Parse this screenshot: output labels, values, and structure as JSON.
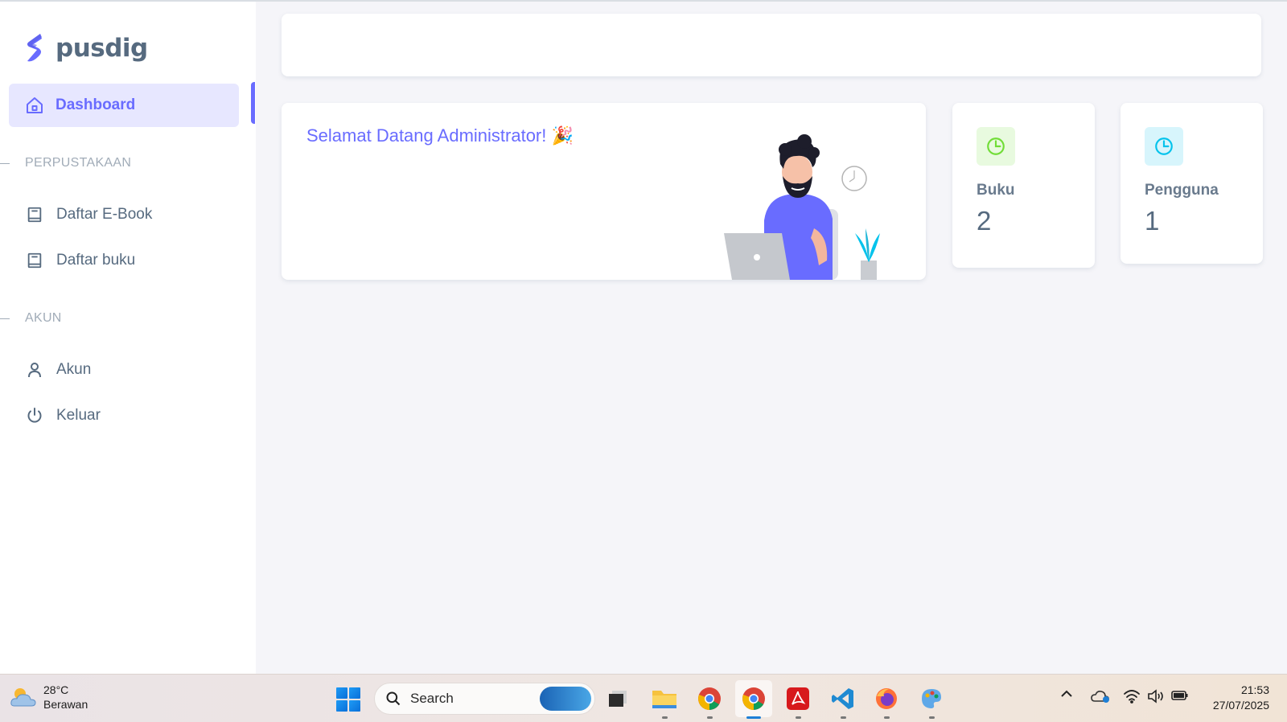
{
  "brand": {
    "name": "pusdig"
  },
  "sidebar": {
    "active_item": {
      "label": "Dashboard",
      "icon": "home-icon"
    },
    "sections": [
      {
        "header": "PERPUSTAKAAN",
        "items": [
          {
            "label": "Daftar E-Book",
            "icon": "book-icon"
          },
          {
            "label": "Daftar buku",
            "icon": "book-icon"
          }
        ]
      },
      {
        "header": "AKUN",
        "items": [
          {
            "label": "Akun",
            "icon": "user-icon"
          },
          {
            "label": "Keluar",
            "icon": "power-icon"
          }
        ]
      }
    ]
  },
  "welcome": {
    "title": "Selamat Datang Administrator! 🎉"
  },
  "stats": [
    {
      "title": "Buku",
      "value": "2",
      "icon": "pie-chart-icon",
      "color": "#71dd37",
      "bg": "#e8fadf"
    },
    {
      "title": "Pengguna",
      "value": "1",
      "icon": "pie-chart-icon",
      "color": "#03c3ec",
      "bg": "#d7f5fc"
    }
  ],
  "colors": {
    "primary": "#696cff",
    "primary_light": "#e7e7ff",
    "text": "#566a7f",
    "muted": "#a1acb8"
  },
  "taskbar": {
    "weather": {
      "temp": "28°C",
      "condition": "Berawan"
    },
    "search_placeholder": "Search",
    "apps": [
      "task-view-icon",
      "file-explorer-icon",
      "chrome-icon",
      "chrome-icon",
      "acrobat-icon",
      "vscode-icon",
      "firefox-icon",
      "paint-icon"
    ],
    "clock": {
      "time": "21:53",
      "date": "27/07/2025"
    }
  }
}
